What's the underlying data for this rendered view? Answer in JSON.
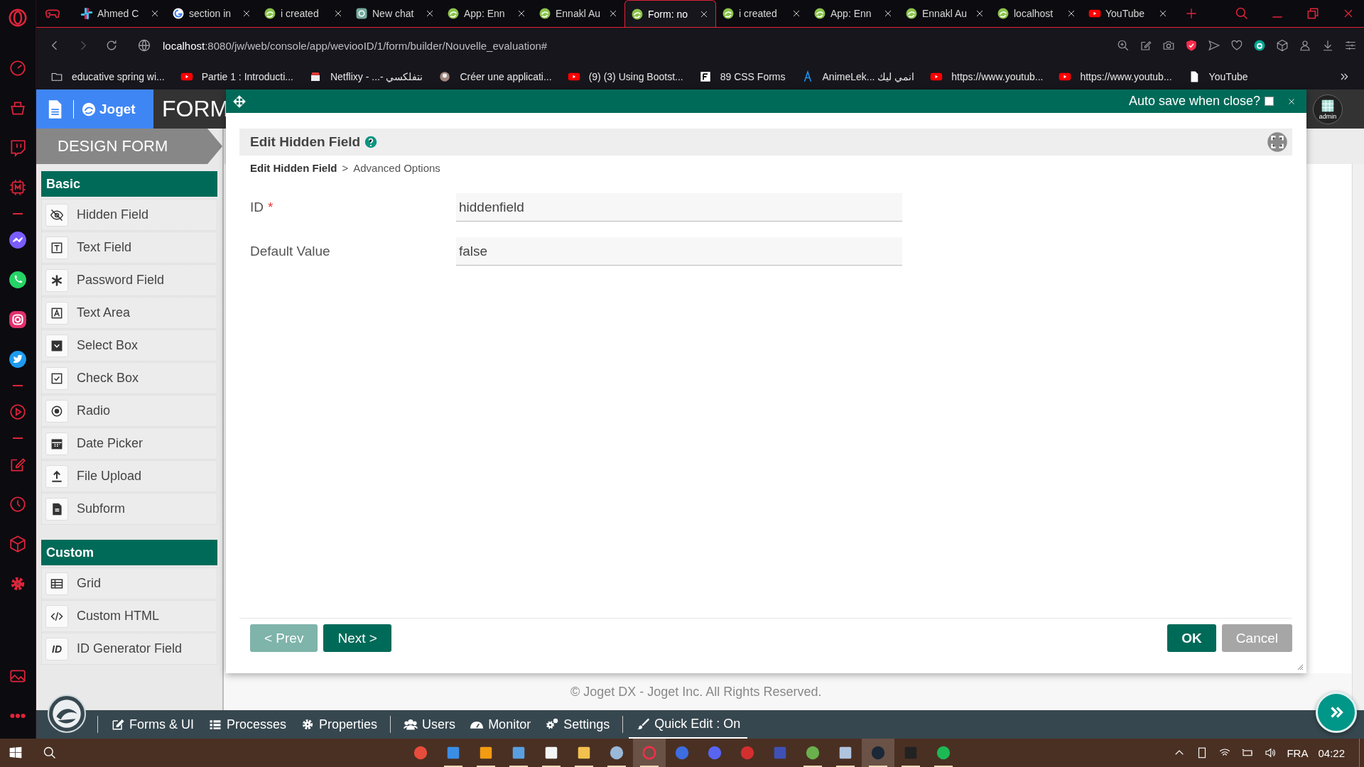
{
  "browser": {
    "tabs": [
      {
        "title": "Ahmed C",
        "kind": "pinwheel",
        "selected": false
      },
      {
        "title": "section in",
        "kind": "ring",
        "selected": false
      },
      {
        "title": "i created",
        "kind": "swirl",
        "selected": false
      },
      {
        "title": "New chat",
        "kind": "knot",
        "selected": false
      },
      {
        "title": "App: Enn",
        "kind": "swirl",
        "selected": false
      },
      {
        "title": "Ennakl Au",
        "kind": "swirl",
        "selected": false
      },
      {
        "title": "Form: no",
        "kind": "swirl",
        "selected": true
      },
      {
        "title": "i created",
        "kind": "swirl",
        "selected": false
      },
      {
        "title": "App: Enn",
        "kind": "swirl",
        "selected": false
      },
      {
        "title": "Ennakl Au",
        "kind": "swirl",
        "selected": false
      },
      {
        "title": "localhost",
        "kind": "swirl",
        "selected": false
      },
      {
        "title": "YouTube",
        "kind": "video",
        "selected": false
      }
    ],
    "url_host": "localhost",
    "url_path": ":8080/jw/web/console/app/weviooID/1/form/builder/Nouvelle_evaluation#",
    "bookmarks": [
      {
        "label": "educative spring wi...",
        "kind": "folder"
      },
      {
        "label": "Partie 1 : Introducti...",
        "kind": "video"
      },
      {
        "label": "Netflixy - ...- نتفلكسي",
        "kind": "store"
      },
      {
        "label": "Créer une applicati...",
        "kind": "avatar"
      },
      {
        "label": "(9) (3) Using Bootst...",
        "kind": "video"
      },
      {
        "label": "89 CSS Forms",
        "kind": "square"
      },
      {
        "label": "AnimeLek... انمي ليك",
        "kind": "anime"
      },
      {
        "label": "https://www.youtub...",
        "kind": "video"
      },
      {
        "label": "https://www.youtub...",
        "kind": "video"
      },
      {
        "label": "YouTube",
        "kind": "page"
      }
    ]
  },
  "app": {
    "logo_text": "Joget",
    "header_title": "FORM",
    "avatar_label": "admin",
    "design_label": "DESIGN FORM",
    "palette": [
      {
        "category": "Basic",
        "items": [
          {
            "label": "Hidden Field",
            "kind": "hidden"
          },
          {
            "label": "Text Field",
            "kind": "text"
          },
          {
            "label": "Password Field",
            "kind": "password"
          },
          {
            "label": "Text Area",
            "kind": "textarea"
          },
          {
            "label": "Select Box",
            "kind": "select"
          },
          {
            "label": "Check Box",
            "kind": "checkbox"
          },
          {
            "label": "Radio",
            "kind": "radio"
          },
          {
            "label": "Date Picker",
            "kind": "date"
          },
          {
            "label": "File Upload",
            "kind": "upload"
          },
          {
            "label": "Subform",
            "kind": "subform"
          }
        ]
      },
      {
        "category": "Custom",
        "items": [
          {
            "label": "Grid",
            "kind": "grid"
          },
          {
            "label": "Custom HTML",
            "kind": "html"
          },
          {
            "label": "ID Generator Field",
            "kind": "idgen",
            "icon_text": "ID"
          }
        ]
      }
    ],
    "footer": "© Joget DX - Joget Inc. All Rights Reserved.",
    "admin_bar": [
      {
        "label": "Forms & UI",
        "kind": "edit",
        "divider_before": true,
        "selected": false
      },
      {
        "label": "Processes",
        "kind": "list",
        "divider_before": false,
        "selected": false
      },
      {
        "label": "Properties",
        "kind": "gear",
        "divider_before": false,
        "selected": false
      },
      {
        "label": "Users",
        "kind": "users",
        "divider_before": true,
        "selected": false
      },
      {
        "label": "Monitor",
        "kind": "gauge",
        "divider_before": false,
        "selected": false
      },
      {
        "label": "Settings",
        "kind": "gears",
        "divider_before": false,
        "selected": false
      },
      {
        "label": "Quick Edit : On",
        "kind": "brush",
        "divider_before": true,
        "selected": true
      }
    ]
  },
  "dialog": {
    "auto_save_label": "Auto save when close?",
    "auto_save_checked": false,
    "title": "Edit Hidden Field",
    "breadcrumb": [
      {
        "label": "Edit Hidden Field",
        "selected": true
      },
      {
        "label": "Advanced Options",
        "selected": false
      }
    ],
    "breadcrumb_separator": ">",
    "fields": [
      {
        "label": "ID",
        "required_mark": "*",
        "value": "hiddenfield"
      },
      {
        "label": "Default Value",
        "value": "false"
      }
    ],
    "prev_button": {
      "label": "< Prev",
      "disabled": true
    },
    "next_button": {
      "label": "Next >",
      "disabled": false
    },
    "ok_button": "OK",
    "cancel_button": "Cancel"
  },
  "taskbar": {
    "language": "FRA",
    "time": "04:22"
  }
}
